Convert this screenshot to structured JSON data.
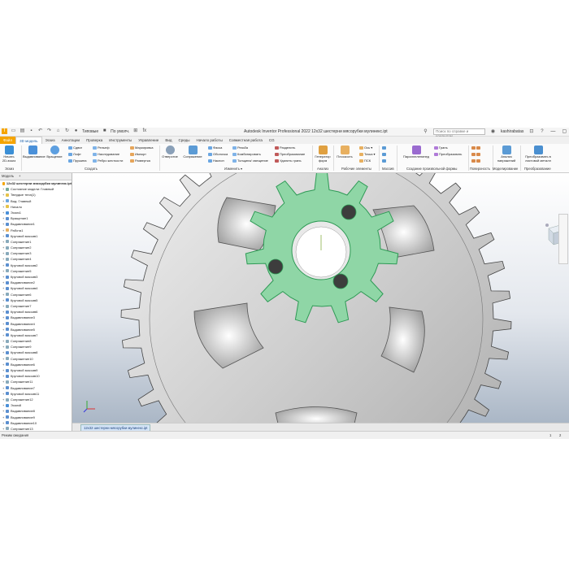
{
  "window": {
    "title": "Autodesk Inventor Professional 2022    12x32 шестерни мясорубки мулинекс.ipt",
    "search_placeholder": "Поиск по справке и командам",
    "user": "kashirabatas",
    "appearance_select": "Типовые",
    "material_select": "По умолч."
  },
  "tabs": [
    "Файл",
    "3D модель",
    "Эскиз",
    "Аннотации",
    "Проверка",
    "Инструменты",
    "Управление",
    "Вид",
    "Среды",
    "Начало работы",
    "Совместная работа",
    "CG"
  ],
  "active_tab": "3D модель",
  "ribbon": {
    "sketch": {
      "start_sketch": "Начать 2D-эскиз",
      "group": "Эскиз"
    },
    "create": {
      "extrude": "Выдавливание",
      "revolve": "Вращение",
      "sweep": "Сдвиг",
      "loft": "Лофт",
      "coil": "Пружина",
      "emboss": "Рельеф",
      "derive": "Наследование",
      "rib": "Ребро жесткости",
      "decal": "Маркировка",
      "import": "Импорт",
      "unwrap": "Развертка",
      "group": "Создать"
    },
    "modify": {
      "hole": "Отверстие",
      "fillet": "Сопряжение",
      "chamfer": "Фаска",
      "shell": "Оболочка",
      "draft": "Наклон",
      "thread": "Резьба",
      "combine": "Комбинировать",
      "thicken": "Толщина/ смещение",
      "split": "Разделить",
      "direct": "Преобразование",
      "delete_face": "Удалить грань",
      "group": "Изменить ▾"
    },
    "explore": {
      "shape_generator": "Генератор форм",
      "group": "Анализ"
    },
    "work_features": {
      "plane": "Плоскость",
      "axis": "Ось ▾",
      "point": "Точка ▾",
      "ucs": "ПСК",
      "group": "Рабочие элементы"
    },
    "pattern": {
      "group": "Массив"
    },
    "freeform": {
      "box": "Параллелепипед",
      "face": "Грань",
      "convert": "Преобразовать",
      "group": "Создание произвольной формы"
    },
    "surface": {
      "group": "Поверхность"
    },
    "simulation": {
      "stress": "Анализ напряжений",
      "group": "Моделирование"
    },
    "convert": {
      "sheet_metal": "Преобразовать в листовой металл",
      "group": "Преобразование"
    }
  },
  "browser": {
    "tabs": [
      "Модель",
      "+"
    ],
    "items": [
      {
        "label": "12x32 шестерни мясорубки мулинекс.ipt",
        "level": 0,
        "icon": "part"
      },
      {
        "label": "Состояние модели: Главный",
        "level": 1,
        "icon": "state"
      },
      {
        "label": "Твердые тела(1)",
        "level": 1,
        "icon": "folder"
      },
      {
        "label": "Вид: Главный",
        "level": 1,
        "icon": "view"
      },
      {
        "label": "Начало",
        "level": 1,
        "icon": "folder"
      },
      {
        "label": "Эскиз1",
        "level": 1,
        "icon": "sketch"
      },
      {
        "label": "Вращение1",
        "level": 1,
        "icon": "feature"
      },
      {
        "label": "Выдавливание1",
        "level": 1,
        "icon": "feature"
      },
      {
        "label": "Работа1",
        "level": 1,
        "icon": "work"
      },
      {
        "label": "Круговой массив1",
        "level": 1,
        "icon": "pattern"
      },
      {
        "label": "Сопряжение1",
        "level": 1,
        "icon": "fillet"
      },
      {
        "label": "Сопряжение2",
        "level": 1,
        "icon": "fillet"
      },
      {
        "label": "Сопряжение3",
        "level": 1,
        "icon": "fillet"
      },
      {
        "label": "Сопряжение4",
        "level": 1,
        "icon": "fillet"
      },
      {
        "label": "Круговой массив2",
        "level": 1,
        "icon": "pattern"
      },
      {
        "label": "Сопряжение5",
        "level": 1,
        "icon": "fillet"
      },
      {
        "label": "Круговой массив3",
        "level": 1,
        "icon": "pattern"
      },
      {
        "label": "Выдавливание2",
        "level": 1,
        "icon": "feature"
      },
      {
        "label": "Круговой массив4",
        "level": 1,
        "icon": "pattern"
      },
      {
        "label": "Сопряжение6",
        "level": 1,
        "icon": "fillet"
      },
      {
        "label": "Круговой массив5",
        "level": 1,
        "icon": "pattern"
      },
      {
        "label": "Сопряжение7",
        "level": 1,
        "icon": "fillet"
      },
      {
        "label": "Круговой массив6",
        "level": 1,
        "icon": "pattern"
      },
      {
        "label": "Выдавливание3",
        "level": 1,
        "icon": "feature"
      },
      {
        "label": "Выдавливание4",
        "level": 1,
        "icon": "feature"
      },
      {
        "label": "Выдавливание5",
        "level": 1,
        "icon": "feature"
      },
      {
        "label": "Круговой массив7",
        "level": 1,
        "icon": "pattern"
      },
      {
        "label": "Сопряжение8",
        "level": 1,
        "icon": "fillet"
      },
      {
        "label": "Сопряжение9",
        "level": 1,
        "icon": "fillet"
      },
      {
        "label": "Круговой массив8",
        "level": 1,
        "icon": "pattern"
      },
      {
        "label": "Сопряжение10",
        "level": 1,
        "icon": "fillet"
      },
      {
        "label": "Выдавливание6",
        "level": 1,
        "icon": "feature"
      },
      {
        "label": "Круговой массив9",
        "level": 1,
        "icon": "pattern"
      },
      {
        "label": "Круговой массив10",
        "level": 1,
        "icon": "pattern"
      },
      {
        "label": "Сопряжение11",
        "level": 1,
        "icon": "fillet"
      },
      {
        "label": "Выдавливание7",
        "level": 1,
        "icon": "feature"
      },
      {
        "label": "Круговой массив11",
        "level": 1,
        "icon": "pattern"
      },
      {
        "label": "Сопряжение12",
        "level": 1,
        "icon": "fillet"
      },
      {
        "label": "Эскиз8",
        "level": 1,
        "icon": "sketch"
      },
      {
        "label": "Выдавливание8",
        "level": 1,
        "icon": "feature"
      },
      {
        "label": "Выдавливание9",
        "level": 1,
        "icon": "feature"
      },
      {
        "label": "Выдавливание10",
        "level": 1,
        "icon": "feature"
      },
      {
        "label": "Сопряжение13",
        "level": 1,
        "icon": "fillet"
      }
    ]
  },
  "document_tab": "12x32 шестерни мясорубки мулинекс.ipt",
  "status": {
    "text": "Режим ожидания",
    "page1": "1",
    "page2": "2"
  },
  "colors": {
    "file_tab": "#f5a400",
    "highlight": "#8fd6a6",
    "highlight_edge": "#2e9a55",
    "viewport_top": "#ffffff",
    "viewport_bottom": "#9aa8b8"
  }
}
